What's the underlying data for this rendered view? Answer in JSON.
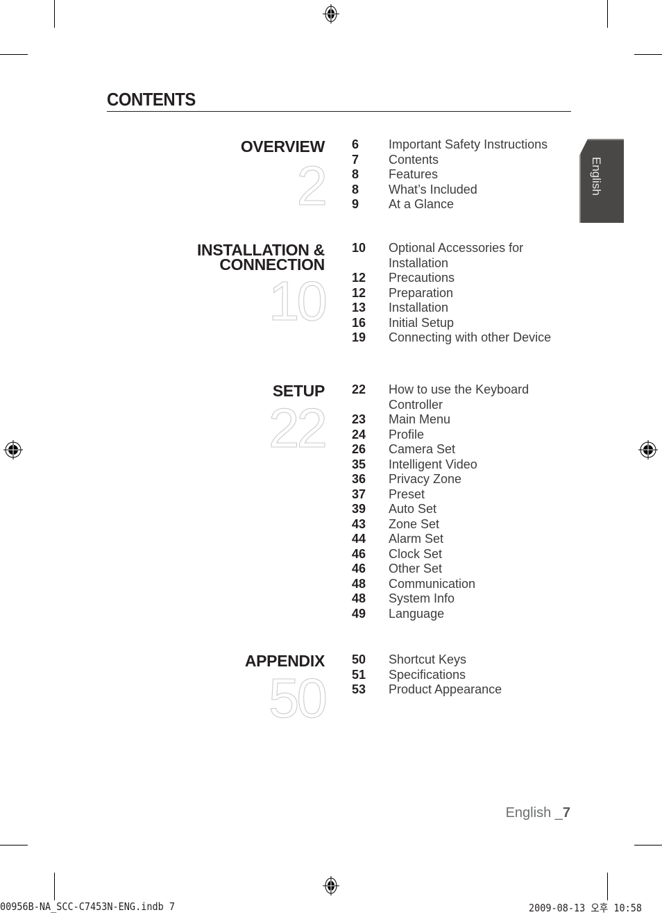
{
  "page": {
    "title": "CONTENTS",
    "language_tab": "English",
    "folio": {
      "language": "English _",
      "page_number": "7"
    },
    "slug_left": "00956B-NA_SCC-C7453N-ENG.indb   7",
    "slug_right": "2009-08-13   오후 10:58"
  },
  "sections": [
    {
      "heading": [
        "OVERVIEW"
      ],
      "start_page": "2",
      "entries": [
        {
          "page": "6",
          "label": "Important Safety Instructions"
        },
        {
          "page": "7",
          "label": "Contents"
        },
        {
          "page": "8",
          "label": "Features"
        },
        {
          "page": "8",
          "label": "What’s Included"
        },
        {
          "page": "9",
          "label": "At a Glance"
        }
      ]
    },
    {
      "heading": [
        "INSTALLATION &",
        "CONNECTION"
      ],
      "start_page": "10",
      "entries": [
        {
          "page": "10",
          "label": "Optional Accessories for Installation"
        },
        {
          "page": "12",
          "label": "Precautions"
        },
        {
          "page": "12",
          "label": "Preparation"
        },
        {
          "page": "13",
          "label": "Installation"
        },
        {
          "page": "16",
          "label": "Initial Setup"
        },
        {
          "page": "19",
          "label": "Connecting with other Device"
        }
      ]
    },
    {
      "heading": [
        "SETUP"
      ],
      "start_page": "22",
      "entries": [
        {
          "page": "22",
          "label": "How to use the Keyboard Controller"
        },
        {
          "page": "23",
          "label": "Main Menu"
        },
        {
          "page": "24",
          "label": "Profile"
        },
        {
          "page": "26",
          "label": "Camera Set"
        },
        {
          "page": "35",
          "label": "Intelligent Video"
        },
        {
          "page": "36",
          "label": "Privacy Zone"
        },
        {
          "page": "37",
          "label": "Preset"
        },
        {
          "page": "39",
          "label": "Auto Set"
        },
        {
          "page": "43",
          "label": "Zone Set"
        },
        {
          "page": "44",
          "label": "Alarm Set"
        },
        {
          "page": "46",
          "label": "Clock Set"
        },
        {
          "page": "46",
          "label": "Other Set"
        },
        {
          "page": "48",
          "label": "Communication"
        },
        {
          "page": "48",
          "label": "System Info"
        },
        {
          "page": "49",
          "label": "Language"
        }
      ]
    },
    {
      "heading": [
        "APPENDIX"
      ],
      "start_page": "50",
      "entries": [
        {
          "page": "50",
          "label": "Shortcut Keys"
        },
        {
          "page": "51",
          "label": "Specifications"
        },
        {
          "page": "53",
          "label": "Product Appearance"
        }
      ]
    }
  ]
}
